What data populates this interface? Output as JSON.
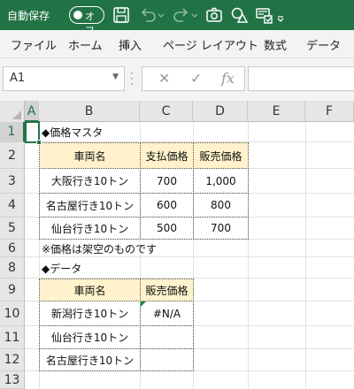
{
  "titlebar": {
    "autosave_label": "自動保存",
    "autosave_state": "オフ",
    "icons": [
      "save-icon",
      "undo-icon",
      "redo-icon",
      "camera-icon",
      "shapes-icon",
      "form-icon"
    ]
  },
  "menu": [
    "ファイル",
    "ホーム",
    "挿入",
    "ページ レイアウト",
    "数式",
    "データ"
  ],
  "formula_bar": {
    "name_box": "A1",
    "cancel": "✕",
    "enter": "✓",
    "fx": "fx",
    "formula": ""
  },
  "columns": [
    "A",
    "B",
    "C",
    "D",
    "E",
    "F"
  ],
  "selected_column": "A",
  "rows": [
    "1",
    "2",
    "3",
    "4",
    "5",
    "6",
    "8",
    "9",
    "10",
    "11",
    "12",
    "13"
  ],
  "selected_row": "1",
  "sheet": {
    "title1": "◆価格マスタ",
    "master_headers": [
      "車両名",
      "支払価格",
      "販売価格"
    ],
    "master_rows": [
      [
        "大阪行き10トン",
        "700",
        "1,000"
      ],
      [
        "名古屋行き10トン",
        "600",
        "800"
      ],
      [
        "仙台行き10トン",
        "500",
        "700"
      ]
    ],
    "note": "※価格は架空のものです",
    "title2": "◆データ",
    "data_headers": [
      "車両名",
      "販売価格"
    ],
    "data_rows": [
      [
        "新潟行き10トン",
        "#N/A"
      ],
      [
        "仙台行き10トン",
        ""
      ],
      [
        "名古屋行き10トン",
        ""
      ]
    ]
  },
  "colors": {
    "accent": "#217346",
    "header_fill": "#fff2cc",
    "error_indicator": "#1e8c3a"
  }
}
